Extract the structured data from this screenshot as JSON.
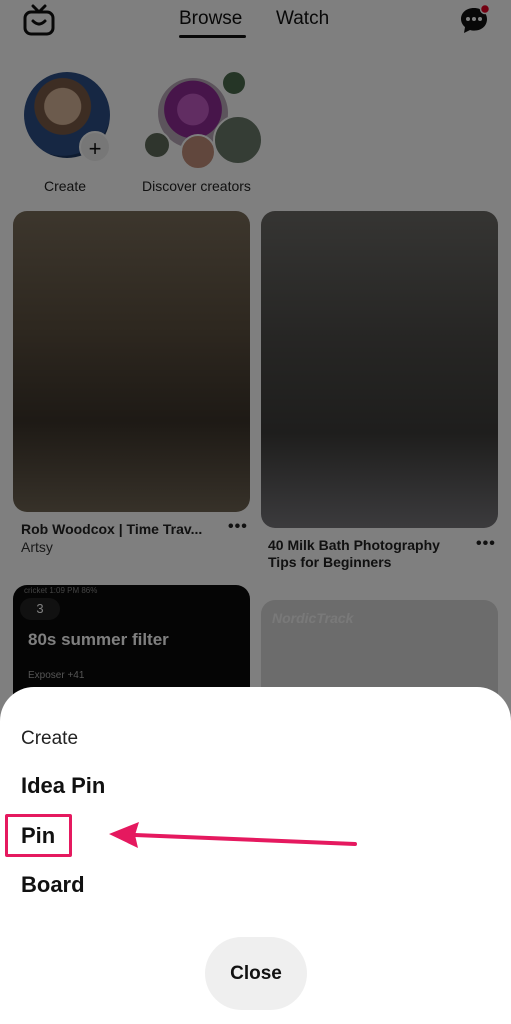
{
  "header": {
    "tabs": [
      {
        "label": "Browse",
        "active": true
      },
      {
        "label": "Watch",
        "active": false
      }
    ],
    "icons": {
      "left": "tv-icon",
      "right": "messages-icon"
    }
  },
  "stories": [
    {
      "label": "Create"
    },
    {
      "label": "Discover creators"
    }
  ],
  "pins": [
    {
      "title": "Rob Woodcox | Time Trav...",
      "subtitle": "Artsy"
    },
    {
      "title": "40 Milk Bath Photography Tips for Beginners",
      "subtitle": ""
    },
    {
      "badge": "3",
      "overlay_title": "80s summer filter",
      "overlay_sub": "Exposer +41",
      "status_bar": "cricket   1:09 PM   86%"
    },
    {
      "brand_text": "NordicTrack"
    }
  ],
  "sheet": {
    "heading": "Create",
    "items": [
      "Idea Pin",
      "Pin",
      "Board"
    ],
    "close_label": "Close",
    "highlighted_item": "Pin",
    "highlight_color": "#e5195f"
  },
  "colors": {
    "accent": "#e5195f",
    "overlay": "rgba(0,0,0,0.5)",
    "notification": "#e60023"
  }
}
